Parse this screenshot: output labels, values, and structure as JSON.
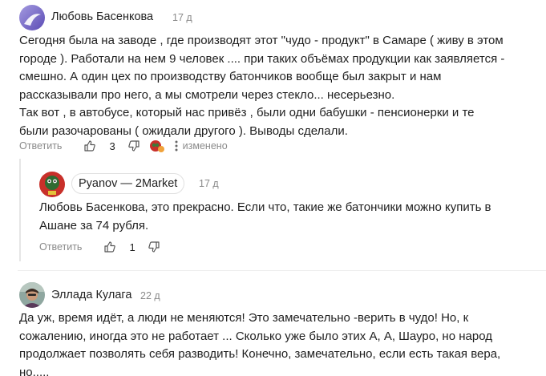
{
  "comments": [
    {
      "author": "Любовь Басенкова",
      "age": "17 д",
      "text": "Сегодня была на заводе , где производят этот \"чудо - продукт\" в Самаре ( живу в этом\nгороде ). Работали на нем 9 человек .... при таких объёмах продукции как заявляется -\nсмешно. А один цех по производству батончиков вообще был закрыт и нам\nрассказывали про него, а мы смотрели через стекло... несерьезно.\nТак вот , в автобусе, который нас привёз , были одни бабушки - пенсионерки и те\nбыли разочарованы ( ожидали другого ). Выводы сделали.",
      "reply_label": "Ответить",
      "likes": "3",
      "edited": "изменено"
    },
    {
      "author": "Pyanov — 2Market",
      "age": "17 д",
      "text": "Любовь Басенкова, это прекрасно. Если что, такие же батончики можно купить в\nАшане за 74 рубля.",
      "reply_label": "Ответить",
      "likes": "1"
    },
    {
      "author": "Эллада Кулага",
      "age": "22 д",
      "text": "Да уж, время идёт, а люди не меняются! Это замечательно -верить в чудо! Но, к\nсожалению, иногда это не работает ... Сколько уже было этих А, А, Шауро, но народ\nпродолжает позволять себя разводить! Конечно, замечательно, если есть такая вера,\nно....."
    }
  ],
  "colors": {
    "text": "#1f1f1f",
    "muted": "#8a8a8a",
    "avatar1": "#7a6cc4",
    "avatar2": "#c8302a"
  },
  "icons": [
    "thumbs-up-icon",
    "thumbs-down-icon",
    "more-dots-icon",
    "reaction-icon"
  ]
}
